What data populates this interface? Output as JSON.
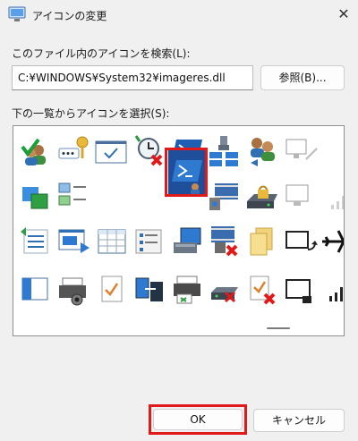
{
  "window": {
    "title": "アイコンの変更",
    "close_glyph": "✕"
  },
  "search": {
    "label": "このファイル内のアイコンを検索(L):",
    "path_value": "C:¥WINDOWS¥System32¥imageres.dll",
    "browse_label": "参照(B)..."
  },
  "list": {
    "label": "下の一覧からアイコンを選択(S):",
    "icons": [
      "users-check-icon",
      "password-key-icon",
      "checkbox-window-icon",
      "clock-error-icon",
      "powershell-icon",
      "network-plug-icon",
      "users-sync-icon",
      "display-link-icon",
      "display-copy-icon",
      "picture-list-icon",
      "blank-icon",
      "powershell-admin-icon",
      "media-film-icon",
      "drive-lock-icon",
      "display-dim-icon",
      "signal-faded-icon",
      "list-back-icon",
      "window-play-icon",
      "table-grid-icon",
      "list-form-icon",
      "network-computer-icon",
      "media-film-error-icon",
      "folders-yellow-icon",
      "display-rotate-icon",
      "window-pane-icon",
      "printer-camera-icon",
      "document-check-icon",
      "monitors-arrow-icon",
      "printer-sync-icon",
      "drive-error-icon",
      "document-check-error-icon",
      "display-fullscreen-icon"
    ],
    "selected_index": 11
  },
  "buttons": {
    "ok": "OK",
    "cancel": "キャンセル"
  }
}
